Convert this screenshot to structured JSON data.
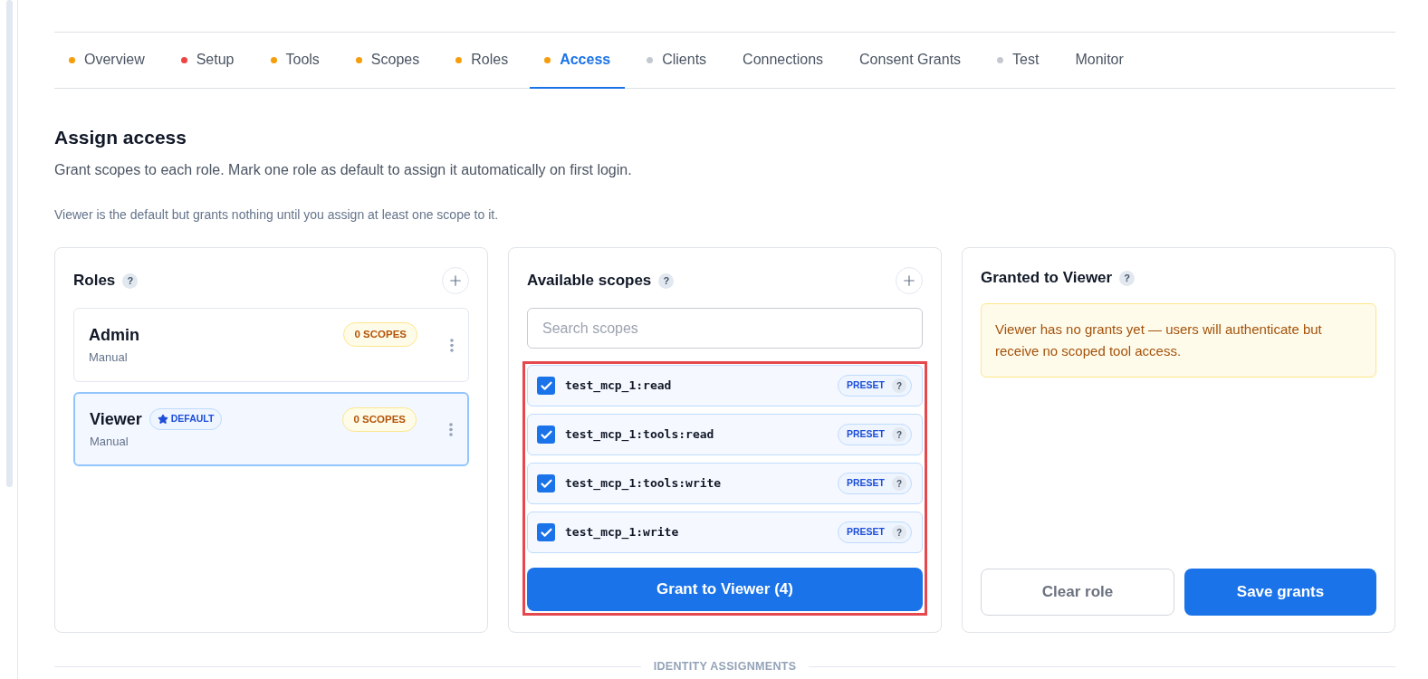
{
  "tabs": [
    {
      "label": "Overview",
      "selected": false,
      "color": "#f59e0b"
    },
    {
      "label": "Setup",
      "selected": false,
      "color": "#ef4444"
    },
    {
      "label": "Tools",
      "selected": false,
      "color": "#f59e0b"
    },
    {
      "label": "Scopes",
      "selected": false,
      "color": "#f59e0b"
    },
    {
      "label": "Roles",
      "selected": false,
      "color": "#f59e0b"
    },
    {
      "label": "Access",
      "selected": true,
      "color": "#f59e0b"
    },
    {
      "label": "Clients",
      "selected": false,
      "color": "#c4c9d0"
    },
    {
      "label": "Connections",
      "selected": false
    },
    {
      "label": "Consent Grants",
      "selected": false
    },
    {
      "label": "Test",
      "selected": false,
      "color": "#c4c9d0"
    },
    {
      "label": "Monitor",
      "selected": false
    }
  ],
  "header": {
    "title": "Assign access",
    "subtitle": "Grant scopes to each role. Mark one role as default to assign it automatically on first login.",
    "note": "Viewer is the default but grants nothing until you assign at least one scope to it."
  },
  "roles_panel": {
    "title": "Roles",
    "help": "?",
    "roles": [
      {
        "name": "Admin",
        "source": "Manual",
        "scope_count": "0 SCOPES",
        "selected": false
      },
      {
        "name": "Viewer",
        "default_badge": "DEFAULT",
        "source": "Manual",
        "scope_count": "0 SCOPES",
        "selected": true
      }
    ]
  },
  "scopes_panel": {
    "title": "Available scopes",
    "help": "?",
    "search": {
      "placeholder": "Search scopes"
    },
    "highlighted": true,
    "scopes": [
      {
        "name": "test_mcp_1:read",
        "checked": true,
        "tag": "PRESET",
        "help": "?"
      },
      {
        "name": "test_mcp_1:tools:read",
        "checked": true,
        "tag": "PRESET",
        "help": "?"
      },
      {
        "name": "test_mcp_1:tools:write",
        "checked": true,
        "tag": "PRESET",
        "help": "?"
      },
      {
        "name": "test_mcp_1:write",
        "checked": true,
        "tag": "PRESET",
        "help": "?"
      }
    ],
    "grant_button": "Grant to Viewer (4)"
  },
  "granted_panel": {
    "title": "Granted to Viewer",
    "help": "?",
    "notice": "Viewer has no grants yet — users will authenticate but receive no scoped tool access.",
    "buttons": [
      {
        "label": "Clear role",
        "kind": "secondary"
      },
      {
        "label": "Save grants",
        "kind": "primary"
      }
    ]
  },
  "section_divider": {
    "label": "IDENTITY ASSIGNMENTS"
  }
}
